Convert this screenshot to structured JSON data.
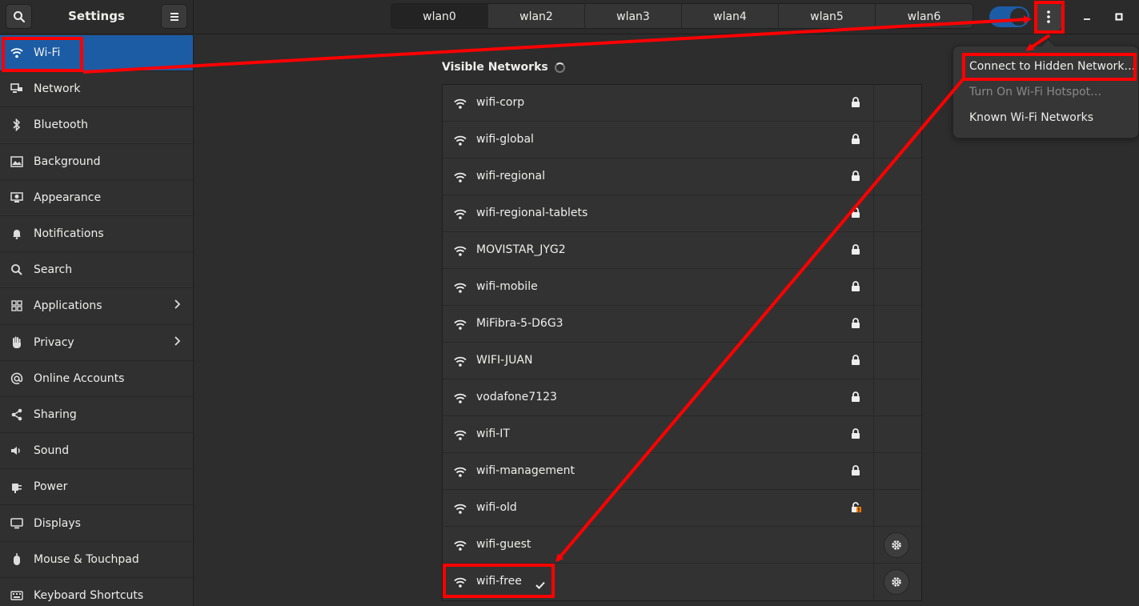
{
  "sidebar": {
    "title": "Settings",
    "items": [
      {
        "label": "Wi-Fi",
        "icon": "wifi-icon",
        "active": true
      },
      {
        "label": "Network",
        "icon": "network-icon"
      },
      {
        "label": "Bluetooth",
        "icon": "bluetooth-icon"
      },
      {
        "label": "Background",
        "icon": "background-icon"
      },
      {
        "label": "Appearance",
        "icon": "appearance-icon"
      },
      {
        "label": "Notifications",
        "icon": "bell-icon"
      },
      {
        "label": "Search",
        "icon": "search-icon"
      },
      {
        "label": "Applications",
        "icon": "apps-grid-icon",
        "has_submenu": true
      },
      {
        "label": "Privacy",
        "icon": "hand-icon",
        "has_submenu": true
      },
      {
        "label": "Online Accounts",
        "icon": "at-icon"
      },
      {
        "label": "Sharing",
        "icon": "share-icon"
      },
      {
        "label": "Sound",
        "icon": "speaker-icon"
      },
      {
        "label": "Power",
        "icon": "power-plug-icon"
      },
      {
        "label": "Displays",
        "icon": "display-icon"
      },
      {
        "label": "Mouse & Touchpad",
        "icon": "mouse-icon"
      },
      {
        "label": "Keyboard Shortcuts",
        "icon": "keyboard-icon"
      }
    ]
  },
  "header": {
    "tabs": [
      "wlan0",
      "wlan2",
      "wlan3",
      "wlan4",
      "wlan5",
      "wlan6"
    ],
    "active_tab": "wlan0",
    "wifi_enabled": true
  },
  "content": {
    "section_title": "Visible Networks",
    "networks": [
      {
        "name": "wifi-corp",
        "secured": true
      },
      {
        "name": "wifi-global",
        "secured": true
      },
      {
        "name": "wifi-regional",
        "secured": true
      },
      {
        "name": "wifi-regional-tablets",
        "secured": true
      },
      {
        "name": "MOVISTAR_JYG2",
        "secured": true
      },
      {
        "name": "wifi-mobile",
        "secured": true
      },
      {
        "name": "MiFibra-5-D6G3",
        "secured": true
      },
      {
        "name": "WIFI-JUAN",
        "secured": true
      },
      {
        "name": "vodafone7123",
        "secured": true
      },
      {
        "name": "wifi-IT",
        "secured": true
      },
      {
        "name": "wifi-management",
        "secured": true
      },
      {
        "name": "wifi-old",
        "secured": true,
        "insecure_warning": true
      },
      {
        "name": "wifi-guest",
        "secured": false,
        "has_settings": true
      },
      {
        "name": "wifi-free",
        "secured": false,
        "has_settings": true,
        "connected": true
      }
    ]
  },
  "menu": {
    "items": [
      {
        "label": "Connect to Hidden Network…",
        "enabled": true
      },
      {
        "label": "Turn On Wi-Fi Hotspot…",
        "enabled": false
      },
      {
        "label": "Known Wi-Fi Networks",
        "enabled": true
      }
    ]
  },
  "colors": {
    "accent": "#1c5ca5",
    "annotation": "#ff0000",
    "warning": "#f57900"
  }
}
